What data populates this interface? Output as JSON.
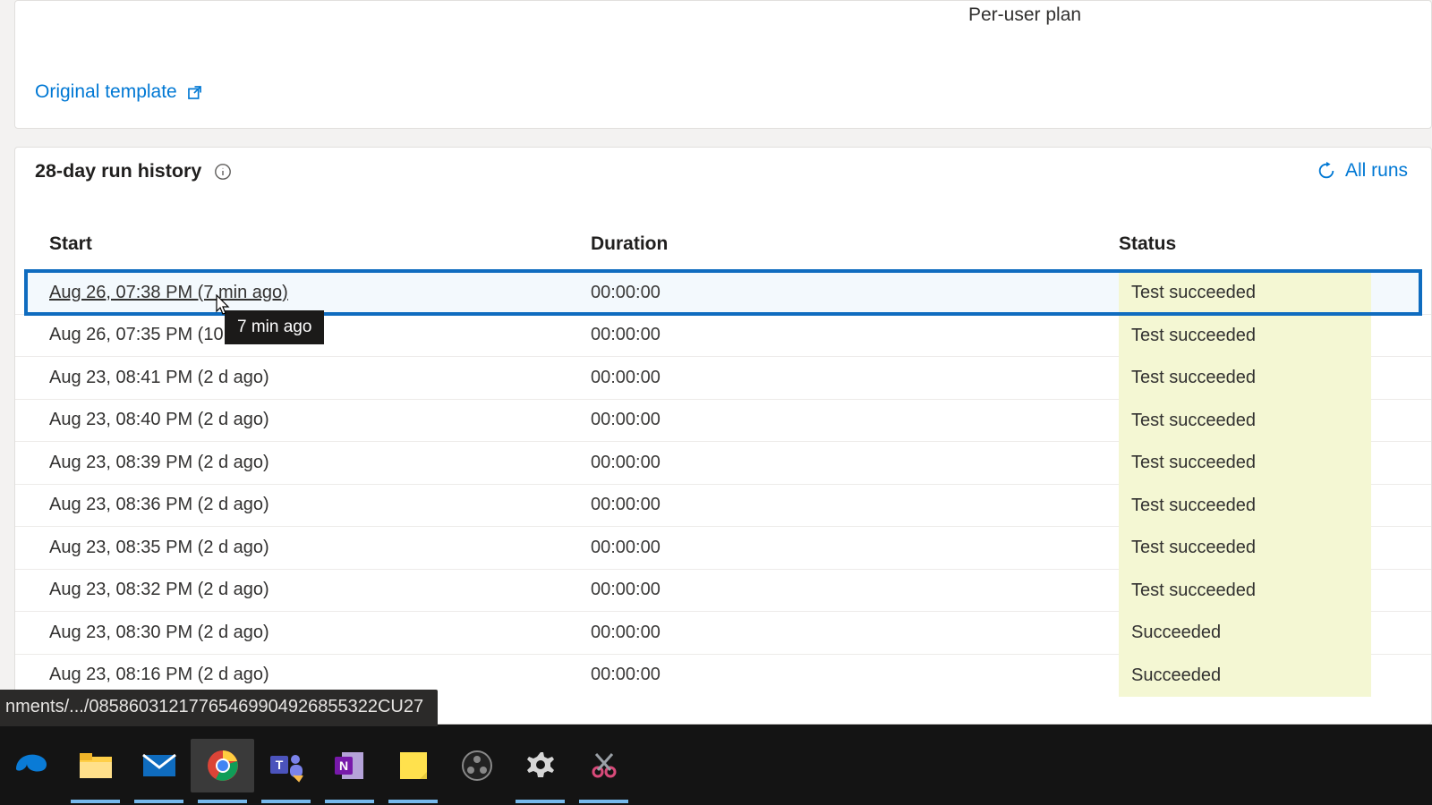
{
  "topCard": {
    "planLabel": "Per-user plan",
    "originalTemplateLabel": "Original template"
  },
  "history": {
    "title": "28-day run history",
    "allRunsLabel": "All runs",
    "columns": {
      "start": "Start",
      "duration": "Duration",
      "status": "Status"
    },
    "tooltip": "7 min ago",
    "rows": [
      {
        "start": "Aug 26, 07:38 PM (7 min ago)",
        "duration": "00:00:00",
        "status": "Test succeeded"
      },
      {
        "start": "Aug 26, 07:35 PM (10",
        "duration": "00:00:00",
        "status": "Test succeeded"
      },
      {
        "start": "Aug 23, 08:41 PM (2 d ago)",
        "duration": "00:00:00",
        "status": "Test succeeded"
      },
      {
        "start": "Aug 23, 08:40 PM (2 d ago)",
        "duration": "00:00:00",
        "status": "Test succeeded"
      },
      {
        "start": "Aug 23, 08:39 PM (2 d ago)",
        "duration": "00:00:00",
        "status": "Test succeeded"
      },
      {
        "start": "Aug 23, 08:36 PM (2 d ago)",
        "duration": "00:00:00",
        "status": "Test succeeded"
      },
      {
        "start": "Aug 23, 08:35 PM (2 d ago)",
        "duration": "00:00:00",
        "status": "Test succeeded"
      },
      {
        "start": "Aug 23, 08:32 PM (2 d ago)",
        "duration": "00:00:00",
        "status": "Test succeeded"
      },
      {
        "start": "Aug 23, 08:30 PM (2 d ago)",
        "duration": "00:00:00",
        "status": "Succeeded"
      },
      {
        "start": "Aug 23, 08:16 PM (2 d ago)",
        "duration": "00:00:00",
        "status": "Succeeded"
      }
    ]
  },
  "statusBarText": "nments/.../08586031217765469904926855322CU27",
  "taskbar": {
    "items": [
      {
        "name": "edge",
        "underline": false
      },
      {
        "name": "file-explorer",
        "underline": true
      },
      {
        "name": "mail",
        "underline": true
      },
      {
        "name": "chrome",
        "underline": true,
        "active": true
      },
      {
        "name": "teams",
        "underline": true
      },
      {
        "name": "onenote",
        "underline": true
      },
      {
        "name": "sticky-notes",
        "underline": true
      },
      {
        "name": "obs",
        "underline": false
      },
      {
        "name": "settings",
        "underline": true
      },
      {
        "name": "snip",
        "underline": true
      }
    ]
  }
}
